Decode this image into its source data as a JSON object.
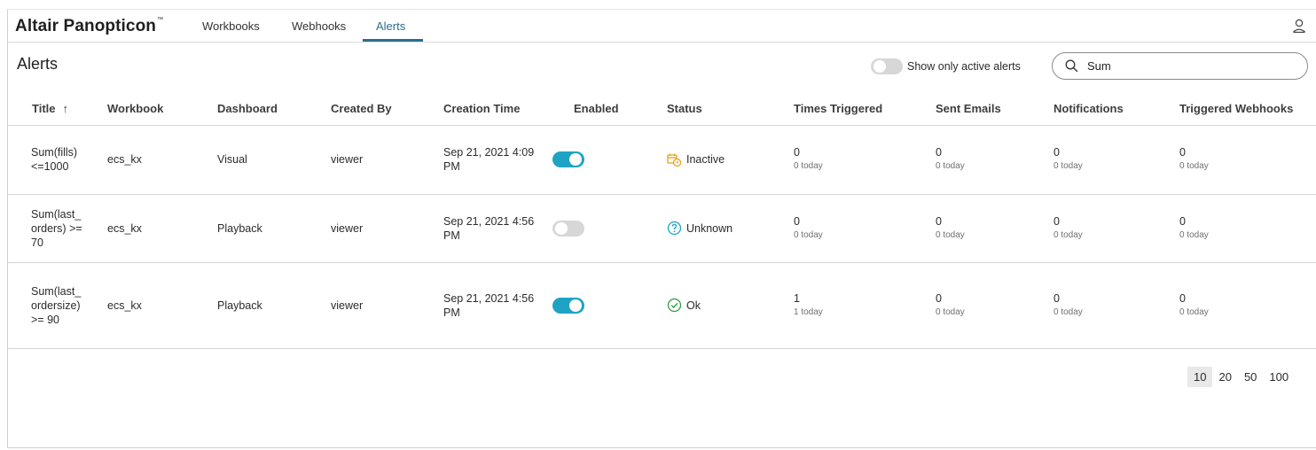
{
  "brand": {
    "name": "Altair Panopticon",
    "tm": "™"
  },
  "nav": {
    "tabs": [
      {
        "label": "Workbooks"
      },
      {
        "label": "Webhooks"
      },
      {
        "label": "Alerts"
      }
    ],
    "active": "Alerts"
  },
  "page": {
    "title": "Alerts"
  },
  "filter": {
    "active_only_label": "Show only active alerts",
    "active_only": false
  },
  "search": {
    "value": "Sum",
    "placeholder": ""
  },
  "table": {
    "headers": {
      "title": "Title",
      "sort_indicator": "↑",
      "workbook": "Workbook",
      "dashboard": "Dashboard",
      "created_by": "Created By",
      "creation_time": "Creation Time",
      "enabled": "Enabled",
      "status": "Status",
      "times_triggered": "Times Triggered",
      "sent_emails": "Sent Emails",
      "notifications": "Notifications",
      "triggered_webhooks": "Triggered Webhooks"
    },
    "rows": [
      {
        "title": "Sum(fills) <=1000",
        "workbook": "ecs_kx",
        "dashboard": "Visual",
        "created_by": "viewer",
        "creation_time": "Sep 21, 2021 4:09 PM",
        "enabled": true,
        "status": "Inactive",
        "status_icon": "calendar-clock-icon",
        "times_triggered": "0",
        "times_triggered_today": "0 today",
        "sent_emails": "0",
        "sent_emails_today": "0 today",
        "notifications": "0",
        "notifications_today": "0 today",
        "triggered_webhooks": "0",
        "triggered_webhooks_today": "0 today"
      },
      {
        "title": "Sum(last_orders) >=70",
        "workbook": "ecs_kx",
        "dashboard": "Playback",
        "created_by": "viewer",
        "creation_time": "Sep 21, 2021 4:56 PM",
        "enabled": false,
        "status": "Unknown",
        "status_icon": "question-circle-icon",
        "times_triggered": "0",
        "times_triggered_today": "0 today",
        "sent_emails": "0",
        "sent_emails_today": "0 today",
        "notifications": "0",
        "notifications_today": "0 today",
        "triggered_webhooks": "0",
        "triggered_webhooks_today": "0 today"
      },
      {
        "title": "Sum(last_ordersize) >= 90",
        "workbook": "ecs_kx",
        "dashboard": "Playback",
        "created_by": "viewer",
        "creation_time": "Sep 21, 2021 4:56 PM",
        "enabled": true,
        "status": "Ok",
        "status_icon": "check-circle-icon",
        "times_triggered": "1",
        "times_triggered_today": "1 today",
        "sent_emails": "0",
        "sent_emails_today": "0 today",
        "notifications": "0",
        "notifications_today": "0 today",
        "triggered_webhooks": "0",
        "triggered_webhooks_today": "0 today"
      }
    ]
  },
  "pager": {
    "sizes": [
      "10",
      "20",
      "50",
      "100"
    ],
    "active": "10"
  },
  "colors": {
    "accent": "#1fa3c4",
    "nav_active": "#2a6f8f",
    "inactive_icon": "#e8a21a",
    "unknown_icon": "#1fa3c4",
    "ok_icon": "#2f9e44"
  }
}
